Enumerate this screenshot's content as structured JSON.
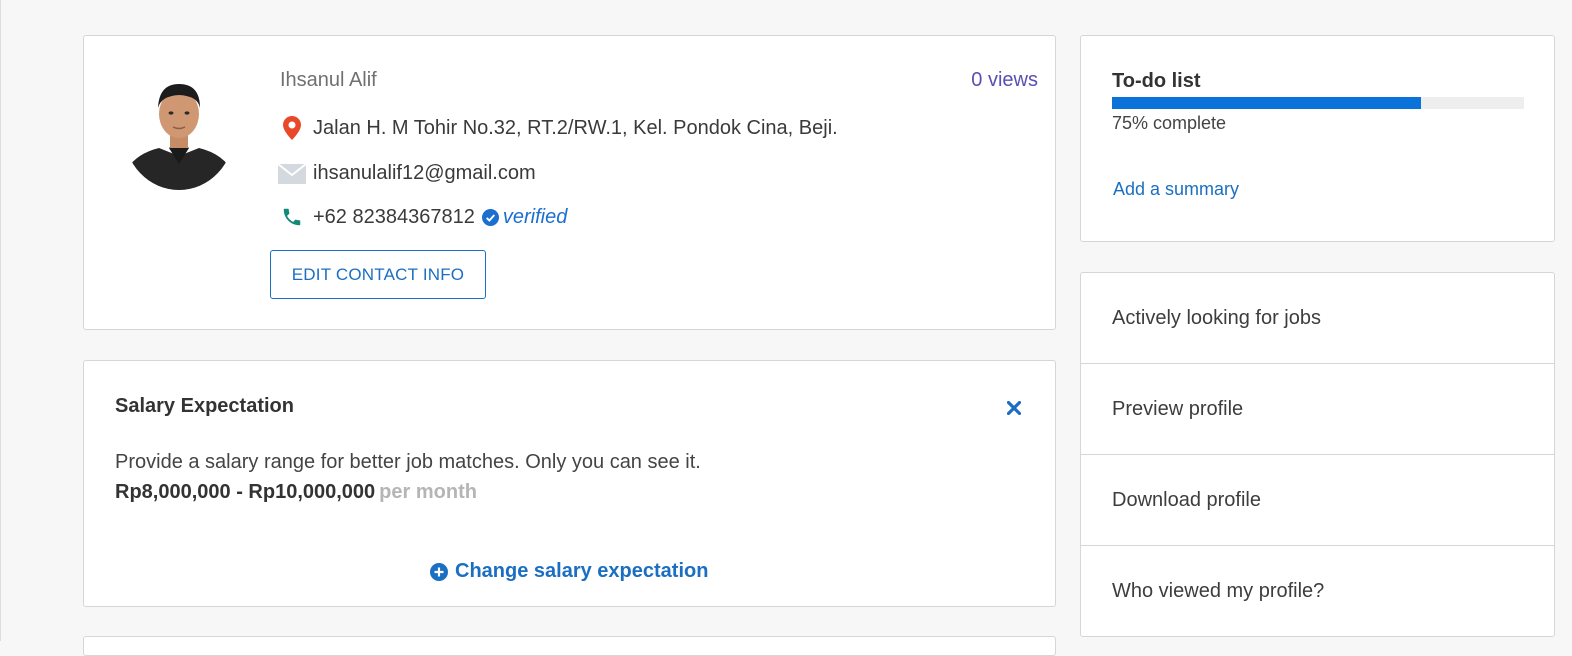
{
  "profile": {
    "name": "Ihsanul Alif",
    "views": "0 views",
    "address": "Jalan H. M Tohir No.32, RT.2/RW.1, Kel. Pondok Cina, Beji.",
    "email": "ihsanulalif12@gmail.com",
    "phone": "+62 82384367812",
    "verified_label": "verified",
    "edit_button": "EDIT CONTACT INFO",
    "icons": [
      "location-pin-icon",
      "envelope-icon",
      "phone-icon",
      "check-circle-icon"
    ]
  },
  "salary": {
    "title": "Salary Expectation",
    "description": "Provide a salary range for better job matches. Only you can see it.",
    "range": "Rp8,000,000 - Rp10,000,000",
    "period": "per month",
    "change_link": "Change salary expectation",
    "icons": [
      "close-icon",
      "plus-circle-icon"
    ]
  },
  "todo": {
    "title": "To-do list",
    "progress": 0.75,
    "progress_text": "75% complete",
    "add_summary": "Add a summary"
  },
  "menu": {
    "items": [
      {
        "label": "Actively looking for jobs"
      },
      {
        "label": "Preview profile"
      },
      {
        "label": "Download profile"
      },
      {
        "label": "Who viewed my profile?"
      }
    ]
  },
  "colors": {
    "accent": "#1b6fc2",
    "progress": "#0a72d9",
    "views": "#5a4fb3",
    "location_pin": "#e8492a",
    "phone": "#13897a"
  }
}
